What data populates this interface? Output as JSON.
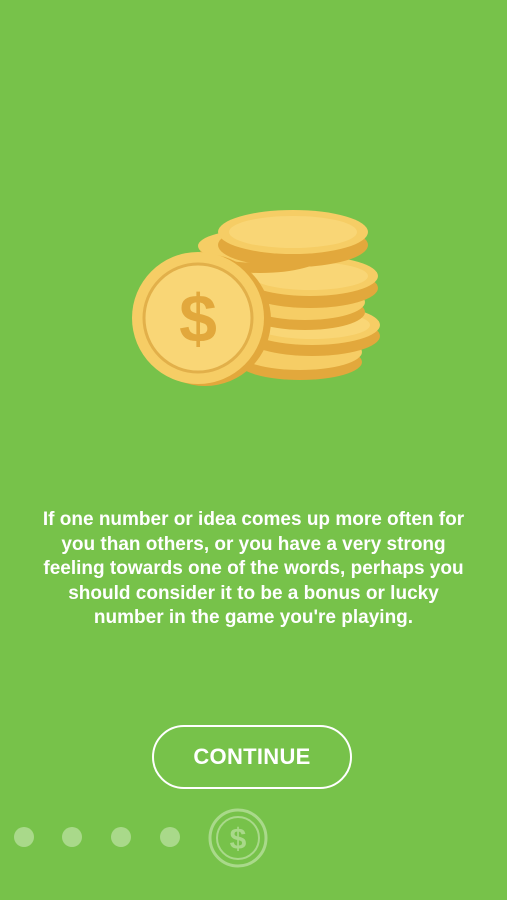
{
  "onboarding": {
    "illustration_icon": "gold-coin-stack-icon",
    "coin_symbol": "$",
    "message": "If one number or idea comes up more often for you than others, or you have a very strong feeling towards one of the words, perhaps you should consider it to be a bonus or lucky number in the game you're playing.",
    "continue_label": "CONTINUE"
  },
  "pager": {
    "total_pages": 5,
    "current_page": 5,
    "current_icon": "dollar-coin-icon",
    "current_symbol": "$"
  },
  "colors": {
    "background": "#77c24a",
    "coin_face": "#f6cd65",
    "coin_edge": "#e2a83c",
    "text": "#ffffff",
    "dot_inactive": "#a9d98a"
  }
}
